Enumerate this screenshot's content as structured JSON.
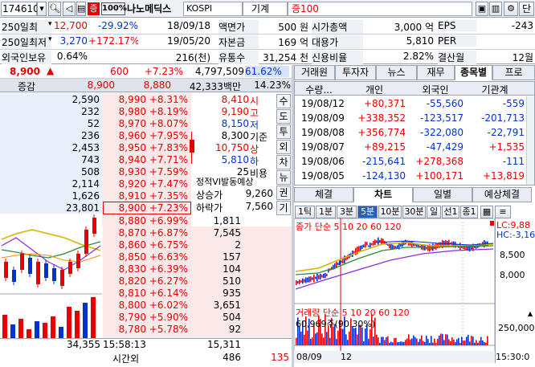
{
  "toolbar": {
    "code": "174610",
    "tag_cert": "증",
    "margin": "100%",
    "name": "나노메딕스",
    "market": "KOSPI",
    "sector": "기계",
    "margin_rate": "증100",
    "right_btn": "단"
  },
  "info": {
    "rows": [
      [
        "250일최",
        "12,700",
        "-29.92%",
        "18/09/18",
        "액면가",
        "500 원",
        "시가총액",
        "3,000 억",
        "EPS",
        "-243"
      ],
      [
        "250일최저",
        "3,270",
        "+172.17%",
        "19/05/20",
        "자본금",
        "169 억",
        "대용가",
        "5,810",
        "PER",
        ""
      ],
      [
        "외국인보유",
        "0.64%",
        "",
        "216(천)",
        "유통수",
        "31,254 천",
        "신용비율",
        "2.82%",
        "결산월",
        "12월"
      ]
    ]
  },
  "price": {
    "current": "8,900",
    "arrow": "▲",
    "change": "600",
    "rate": "+7.23%",
    "volume": "4,797,509",
    "vol_rate": "61.62%"
  },
  "orderbook": {
    "head": {
      "label": "증감",
      "p1": "8,900",
      "p2": "8,880",
      "amount": "42,333백만",
      "pct": "14.23%"
    },
    "asks": [
      [
        "2,590",
        "8,990",
        "+8.31%"
      ],
      [
        "232",
        "8,980",
        "+8.19%"
      ],
      [
        "52",
        "8,970",
        "+8.07%"
      ],
      [
        "236",
        "8,960",
        "+7.95%"
      ],
      [
        "2,453",
        "8,950",
        "+7.83%"
      ],
      [
        "743",
        "8,940",
        "+7.71%"
      ],
      [
        "508",
        "8,930",
        "+7.59%"
      ],
      [
        "2,114",
        "8,920",
        "+7.47%"
      ],
      [
        "1,626",
        "8,910",
        "+7.35%"
      ],
      [
        "23,801",
        "8,900",
        "+7.23%"
      ]
    ],
    "bids": [
      [
        "8,880",
        "+6.99%",
        "1,811"
      ],
      [
        "8,870",
        "+6.87%",
        "7,545"
      ],
      [
        "8,860",
        "+6.75%",
        "2"
      ],
      [
        "8,850",
        "+6.63%",
        "157"
      ],
      [
        "8,830",
        "+6.39%",
        "104"
      ],
      [
        "8,820",
        "+6.27%",
        "510"
      ],
      [
        "8,810",
        "+6.14%",
        "935"
      ],
      [
        "8,800",
        "+6.02%",
        "3,651"
      ],
      [
        "8,790",
        "+5.90%",
        "504"
      ],
      [
        "8,780",
        "+5.78%",
        "92"
      ]
    ],
    "ohlc": [
      [
        "8,410",
        "시"
      ],
      [
        "9,190",
        "고"
      ],
      [
        "8,150",
        "저"
      ],
      [
        "8,300",
        "기준"
      ],
      [
        "10,750",
        "상"
      ],
      [
        "5,810",
        "하"
      ],
      [
        "25",
        "비용"
      ]
    ],
    "side_tabs": [
      "수",
      "도",
      "투",
      "외",
      "차",
      "뉴",
      "권",
      "기"
    ],
    "expected_title": "정적VI발동예상",
    "expected": [
      [
        "상승가",
        "9,260"
      ],
      [
        "하락가",
        "7,560"
      ]
    ],
    "footer": {
      "ask_total": "34,355",
      "time": "15:58:13",
      "bid_total": "15,311",
      "after_label": "시간외",
      "after_val": "486",
      "after_red": "135"
    }
  },
  "right": {
    "tabs": [
      "거래원",
      "투자자",
      "뉴스",
      "재무",
      "종목별",
      "프로"
    ],
    "active_tab": "종목별",
    "table_head": [
      "수량...",
      "개인",
      "외국인",
      "기관계"
    ],
    "table_rows": [
      [
        "19/08/12",
        "+80,371",
        "-55,560",
        "-559"
      ],
      [
        "19/08/09",
        "+338,352",
        "-123,517",
        "-201,713"
      ],
      [
        "19/08/08",
        "+356,774",
        "-322,080",
        "-22,791"
      ],
      [
        "19/08/07",
        "+89,215",
        "-47,429",
        "+1,535"
      ],
      [
        "19/08/06",
        "-215,641",
        "+278,368",
        "-111"
      ],
      [
        "19/08/05",
        "-124,130",
        "+100,171",
        "+13,819"
      ]
    ],
    "chart_tabs": [
      "체결",
      "차트",
      "일별",
      "예상체결"
    ],
    "chart_active": "차트",
    "periods": [
      "1틱",
      "1분",
      "3분",
      "5분",
      "10분",
      "30분",
      "일",
      "선1",
      "종1"
    ],
    "period_active": "5분",
    "price_legend": "종가 단순 5 10 20 60 120",
    "price_axis": [
      "LC:9,88",
      "HC:-3,16",
      "8,500",
      "8,000"
    ],
    "vol_legend": "거래량 단순 5 10 20 60 120",
    "vol_note": "60,969주(90.30%)",
    "vol_axis": [
      "250,000"
    ],
    "x_labels": [
      "08/09",
      "12",
      "15:30:0"
    ]
  },
  "colors": {
    "up": "#e60000",
    "down": "#0033cc",
    "ma_yellow": "#d7b300",
    "ma_green": "#2e8b2e",
    "ma_purple": "#8a2be2",
    "ma_orange": "#ff8c00"
  }
}
